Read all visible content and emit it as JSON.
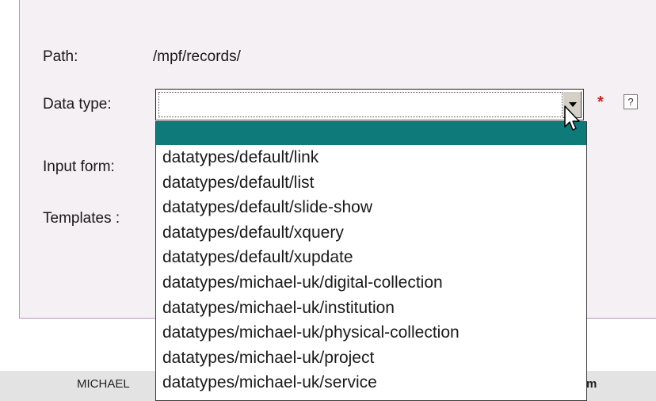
{
  "form": {
    "path_label": "Path:",
    "path_value": "/mpf/records/",
    "datatype_label": "Data type:",
    "datatype_value": "",
    "required_mark": "*",
    "help_mark": "?",
    "inputform_label": "Input form:",
    "templates_label": "Templates :"
  },
  "dropdown": {
    "options": [
      "",
      "datatypes/default/link",
      "datatypes/default/list",
      "datatypes/default/slide-show",
      "datatypes/default/xquery",
      "datatypes/default/xupdate",
      "datatypes/michael-uk/digital-collection",
      "datatypes/michael-uk/institution",
      "datatypes/michael-uk/physical-collection",
      "datatypes/michael-uk/project",
      "datatypes/michael-uk/service"
    ],
    "selected_index": 0
  },
  "footer": {
    "left_text": "MICHAEL",
    "right_text": "m"
  },
  "colors": {
    "selected_option": "#0f7a7a",
    "required": "#cc2222",
    "panel_border": "#b59ab6"
  }
}
